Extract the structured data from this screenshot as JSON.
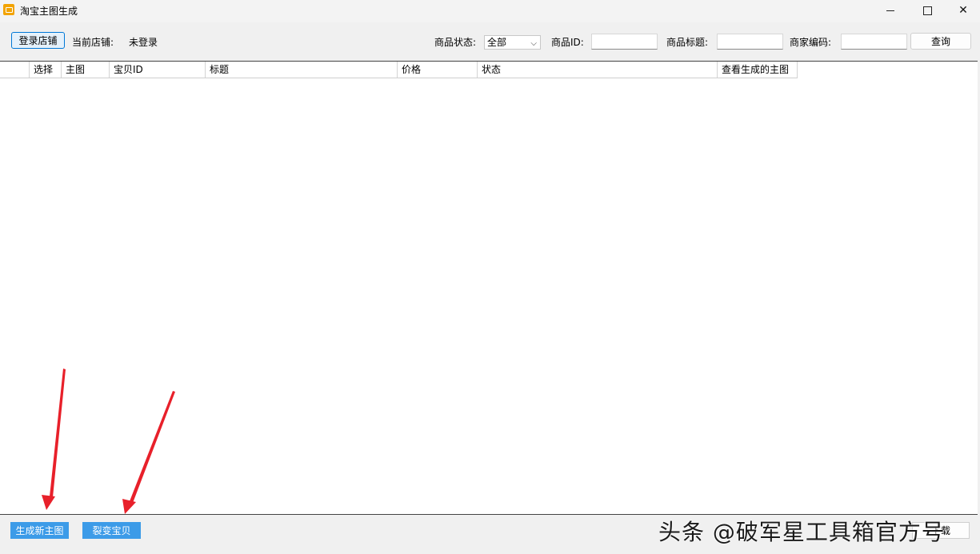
{
  "window": {
    "title": "淘宝主图生成",
    "minimize_glyph": "—",
    "maximize_glyph": "☐",
    "close_glyph": "✕"
  },
  "toolbar": {
    "login_label": "登录店铺",
    "current_store_label": "当前店铺:",
    "current_store_value": "未登录",
    "status_label": "商品状态:",
    "status_selected": "全部",
    "product_id_label": "商品ID:",
    "product_title_label": "商品标题:",
    "merchant_code_label": "商家编码:",
    "query_label": "查询"
  },
  "grid": {
    "columns": [
      "",
      "选择",
      "主图",
      "宝贝ID",
      "标题",
      "价格",
      "状态",
      "查看生成的主图"
    ]
  },
  "bottom": {
    "generate_label": "生成新主图",
    "fission_label": "裂变宝贝",
    "download_label": "下载"
  },
  "watermark": "头条 @破军星工具箱官方号",
  "colors": {
    "accent_blue": "#3c9be8",
    "arrow_red": "#e8202a"
  }
}
